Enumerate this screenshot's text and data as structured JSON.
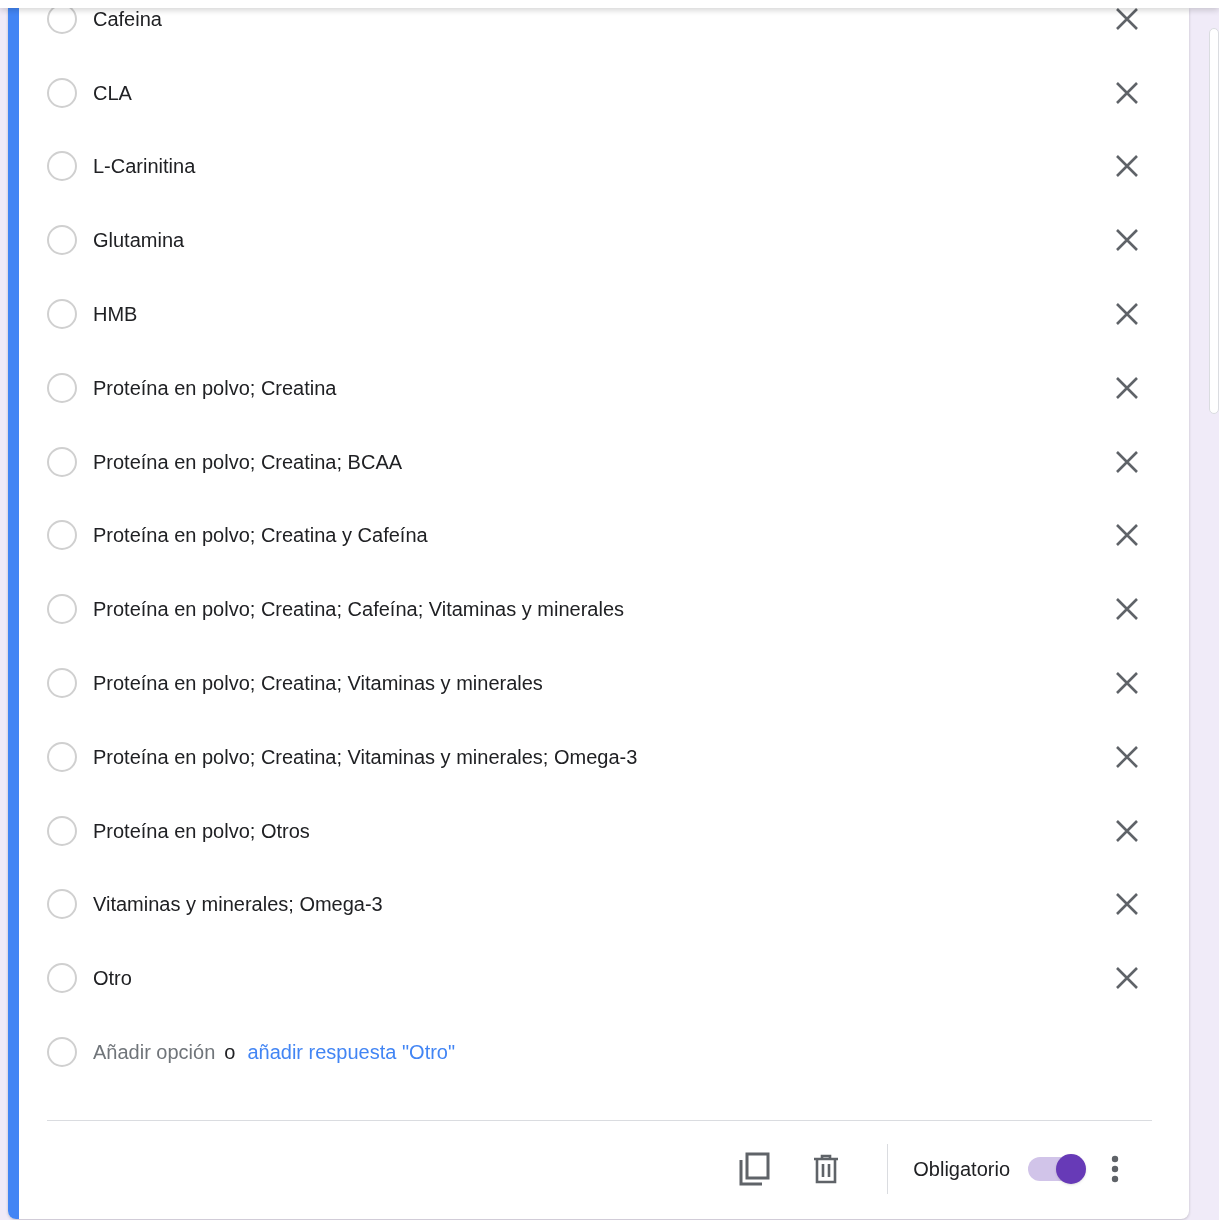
{
  "options": [
    {
      "label": "Cafeina",
      "selected": false
    },
    {
      "label": "CLA",
      "selected": false
    },
    {
      "label": "L-Carinitina",
      "selected": false
    },
    {
      "label": "Glutamina",
      "selected": false
    },
    {
      "label": "HMB",
      "selected": false
    },
    {
      "label": "Proteína en polvo; Creatina",
      "selected": false
    },
    {
      "label": "Proteína en polvo; Creatina; BCAA",
      "selected": false
    },
    {
      "label": "Proteína en polvo; Creatina y Cafeína",
      "selected": false
    },
    {
      "label": "Proteína en polvo; Creatina; Cafeína; Vitaminas y minerales",
      "selected": false
    },
    {
      "label": "Proteína en polvo; Creatina; Vitaminas y minerales",
      "selected": false
    },
    {
      "label": "Proteína en polvo; Creatina; Vitaminas y minerales; Omega-3",
      "selected": false
    },
    {
      "label": "Proteína en polvo; Otros",
      "selected": false
    },
    {
      "label": "Vitaminas y minerales; Omega-3",
      "selected": false
    },
    {
      "label": "Otro",
      "selected": false
    }
  ],
  "add_option": {
    "selected": false,
    "label": "Añadir opción",
    "separator": "o",
    "other_link": "añadir respuesta \"Otro\""
  },
  "footer": {
    "required_label": "Obligatorio",
    "required_on": true
  }
}
